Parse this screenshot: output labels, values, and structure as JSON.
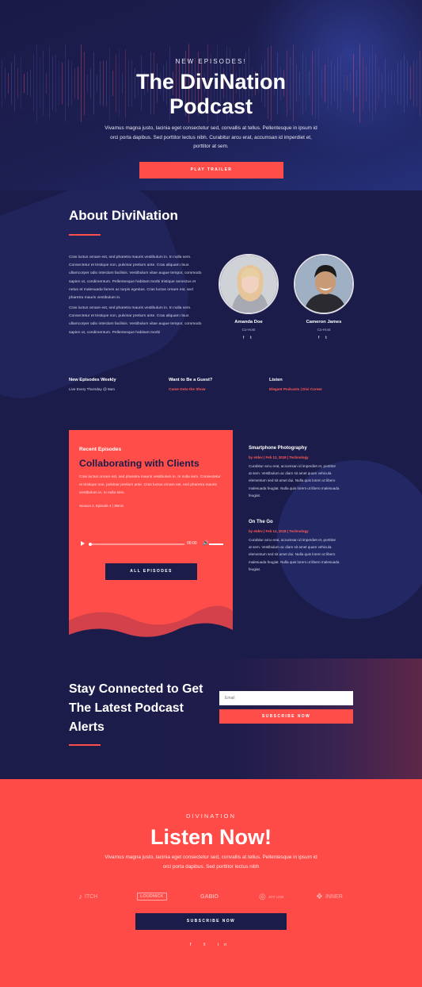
{
  "hero": {
    "kicker": "NEW EPISODES!",
    "title_line1": "The DiviNation",
    "title_line2": "Podcast",
    "description": "Vivamus magna justo, lacinia eget consectetur sed, convallis at tellus. Pellentesque in ipsum id orci porta dapibus. Sed porttitor lectus nibh. Curabitur arcu erat, accumsan id imperdiet et, porttitor at sem.",
    "button": "PLAY TRAILER"
  },
  "about": {
    "title": "About DiviNation",
    "para1": "Cras luctus ornare est, sed pharetra mauris vestibulum in. In nulla sem. Consectetur et tristique non, pulvinar pretium ante. Cras aliquam risus ullamcorper odio interdum facilisis. Vestibulum vitae augue tempor, commodo sapien ut, condimentum. Pellentesque habitant morbi tristique senectus et netus et malesuada fames ac turpis egestas. Cras luctus ornare est, sed pharetra mauris vestibulum in.",
    "para2": "Cras luctus ornare est, sed pharetra mauris vestibulum in. In nulla sem. Consectetur et tristique non, pulvinar pretium ante. Cras aliquam risus ullamcorper odio interdum facilisis. Vestibulum vitae augue tempor, commodo sapien ut, condimentum. Pellentesque habitant morbi",
    "hosts": [
      {
        "name": "Amanda Doe",
        "role": "Co-Host",
        "social": "f  𝕥"
      },
      {
        "name": "Cameron James",
        "role": "Co-Host",
        "social": "f  𝕥"
      }
    ],
    "info": [
      {
        "title": "New Episodes Weekly",
        "value": "Live Every Thursday @ 9am"
      },
      {
        "title": "Want to Be a Guest?",
        "value": "Come Onto the Show"
      },
      {
        "title": "Listen",
        "value": "Elegant Podcasts | Divi Corner"
      }
    ]
  },
  "episodes": {
    "card": {
      "label": "Recent Episodes",
      "title": "Collaborating with Clients",
      "description": "Cras luctus ornare est, sed pharetra mauris vestibulum in. In nulla sem. Consectetur et tristique non, pulvinar pretium ante. Cras luctus ornare est, sed pharetra mauris vestibulum in. In nulla sem.",
      "meta": "Season 2, Episode 4    |    36min",
      "time": "00:00",
      "button": "ALL EPISODES"
    },
    "list": [
      {
        "title": "Smartphone Photography",
        "meta": "by etdev | Feb 12, 2018 | Technology",
        "description": "Curabitur arcu erat, accumsan id imperdiet et, porttitor at sem. Vestibulum ac diam sit amet quam vehicula elementum sed sit amet dui. Nulla quis lorem ut libero malesuada feugiat. Nulla quis lorem ut libero malesuada feugiat."
      },
      {
        "title": "On The Go",
        "meta": "by etdev | Feb 12, 2018 | Technology",
        "description": "Curabitur arcu erat, accumsan id imperdiet et, porttitor at sem. Vestibulum ac diam sit amet quam vehicula elementum sed sit amet dui. Nulla quis lorem ut libero malesuada feugiat. Nulla quis lorem ut libero malesuada feugiat."
      }
    ]
  },
  "connect": {
    "title": "Stay Connected to Get The Latest Podcast Alerts",
    "email_placeholder": "Email",
    "button": "SUBSCRIBE NOW"
  },
  "listen": {
    "kicker": "DIVINATION",
    "title": "Listen Now!",
    "description": "Vivamus magna justo, lacinia eget consectetur sed, convallis at tellus. Pellentesque in ipsum id orci porta dapibus. Sed porttitor lectus nibh",
    "logos": [
      "ITCH",
      "LOUDNICK",
      "GABIO",
      "JOY LINK",
      "INNER"
    ],
    "button": "SUBSCRIBE NOW",
    "social": "f 𝕥 in"
  },
  "colors": {
    "navy": "#1c1c4a",
    "coral": "#ff4d4a",
    "white": "#ffffff"
  }
}
